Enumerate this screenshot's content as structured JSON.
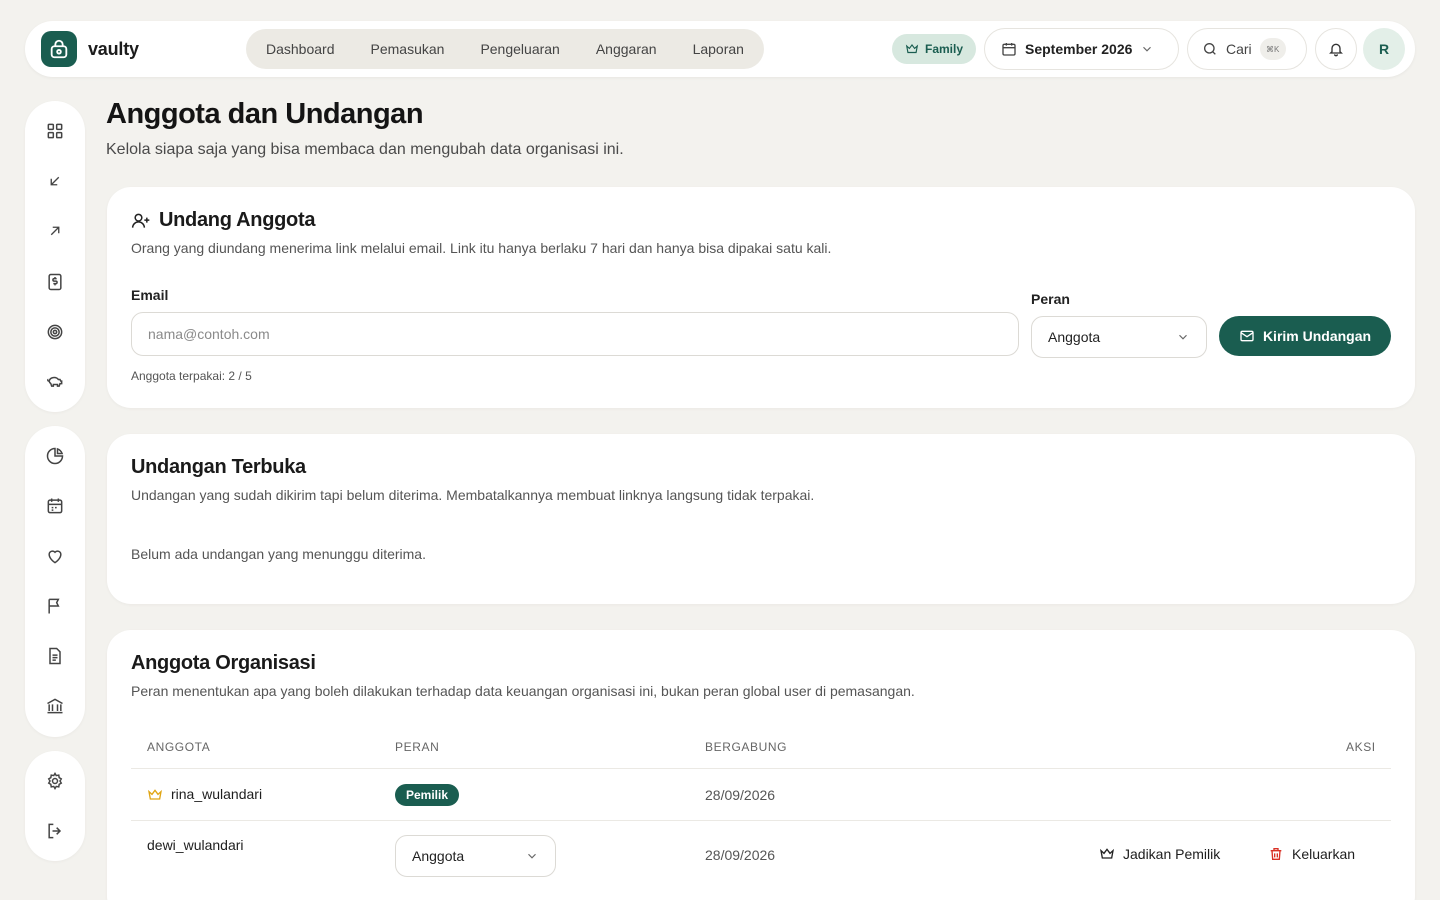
{
  "app": {
    "brand": "vaulty"
  },
  "nav": {
    "items": [
      {
        "label": "Dashboard"
      },
      {
        "label": "Pemasukan"
      },
      {
        "label": "Pengeluaran"
      },
      {
        "label": "Anggaran"
      },
      {
        "label": "Laporan"
      }
    ]
  },
  "header": {
    "plan_badge": "Family",
    "month": "September 2026",
    "search_label": "Cari",
    "search_shortcut": "⌘K",
    "avatar_initial": "R"
  },
  "page": {
    "title": "Anggota dan Undangan",
    "subtitle": "Kelola siapa saja yang bisa membaca dan mengubah data organisasi ini."
  },
  "invite": {
    "title": "Undang Anggota",
    "description": "Orang yang diundang menerima link melalui email. Link itu hanya berlaku 7 hari dan hanya bisa dipakai satu kali.",
    "email_label": "Email",
    "email_placeholder": "nama@contoh.com",
    "email_value": "",
    "role_label": "Peran",
    "role_value": "Anggota",
    "send_label": "Kirim Undangan",
    "quota": "Anggota terpakai: 2 / 5"
  },
  "pending": {
    "title": "Undangan Terbuka",
    "description": "Undangan yang sudah dikirim tapi belum diterima. Membatalkannya membuat linknya langsung tidak terpakai.",
    "empty": "Belum ada undangan yang menunggu diterima."
  },
  "members": {
    "title": "Anggota Organisasi",
    "description": "Peran menentukan apa yang boleh dilakukan terhadap data keuangan organisasi ini, bukan peran global user di pemasangan.",
    "columns": {
      "member": "ANGGOTA",
      "role": "PERAN",
      "joined": "BERGABUNG",
      "actions": "AKSI"
    },
    "rows": [
      {
        "name": "rina_wulandari",
        "role": "Pemilik",
        "joined": "28/09/2026"
      },
      {
        "name": "dewi_wulandari",
        "role": "Anggota",
        "joined": "28/09/2026",
        "make_owner": "Jadikan Pemilik",
        "remove": "Keluarkan"
      }
    ]
  },
  "colors": {
    "accent": "#1a5d50",
    "danger": "#d93025",
    "crown": "#e0a514"
  }
}
